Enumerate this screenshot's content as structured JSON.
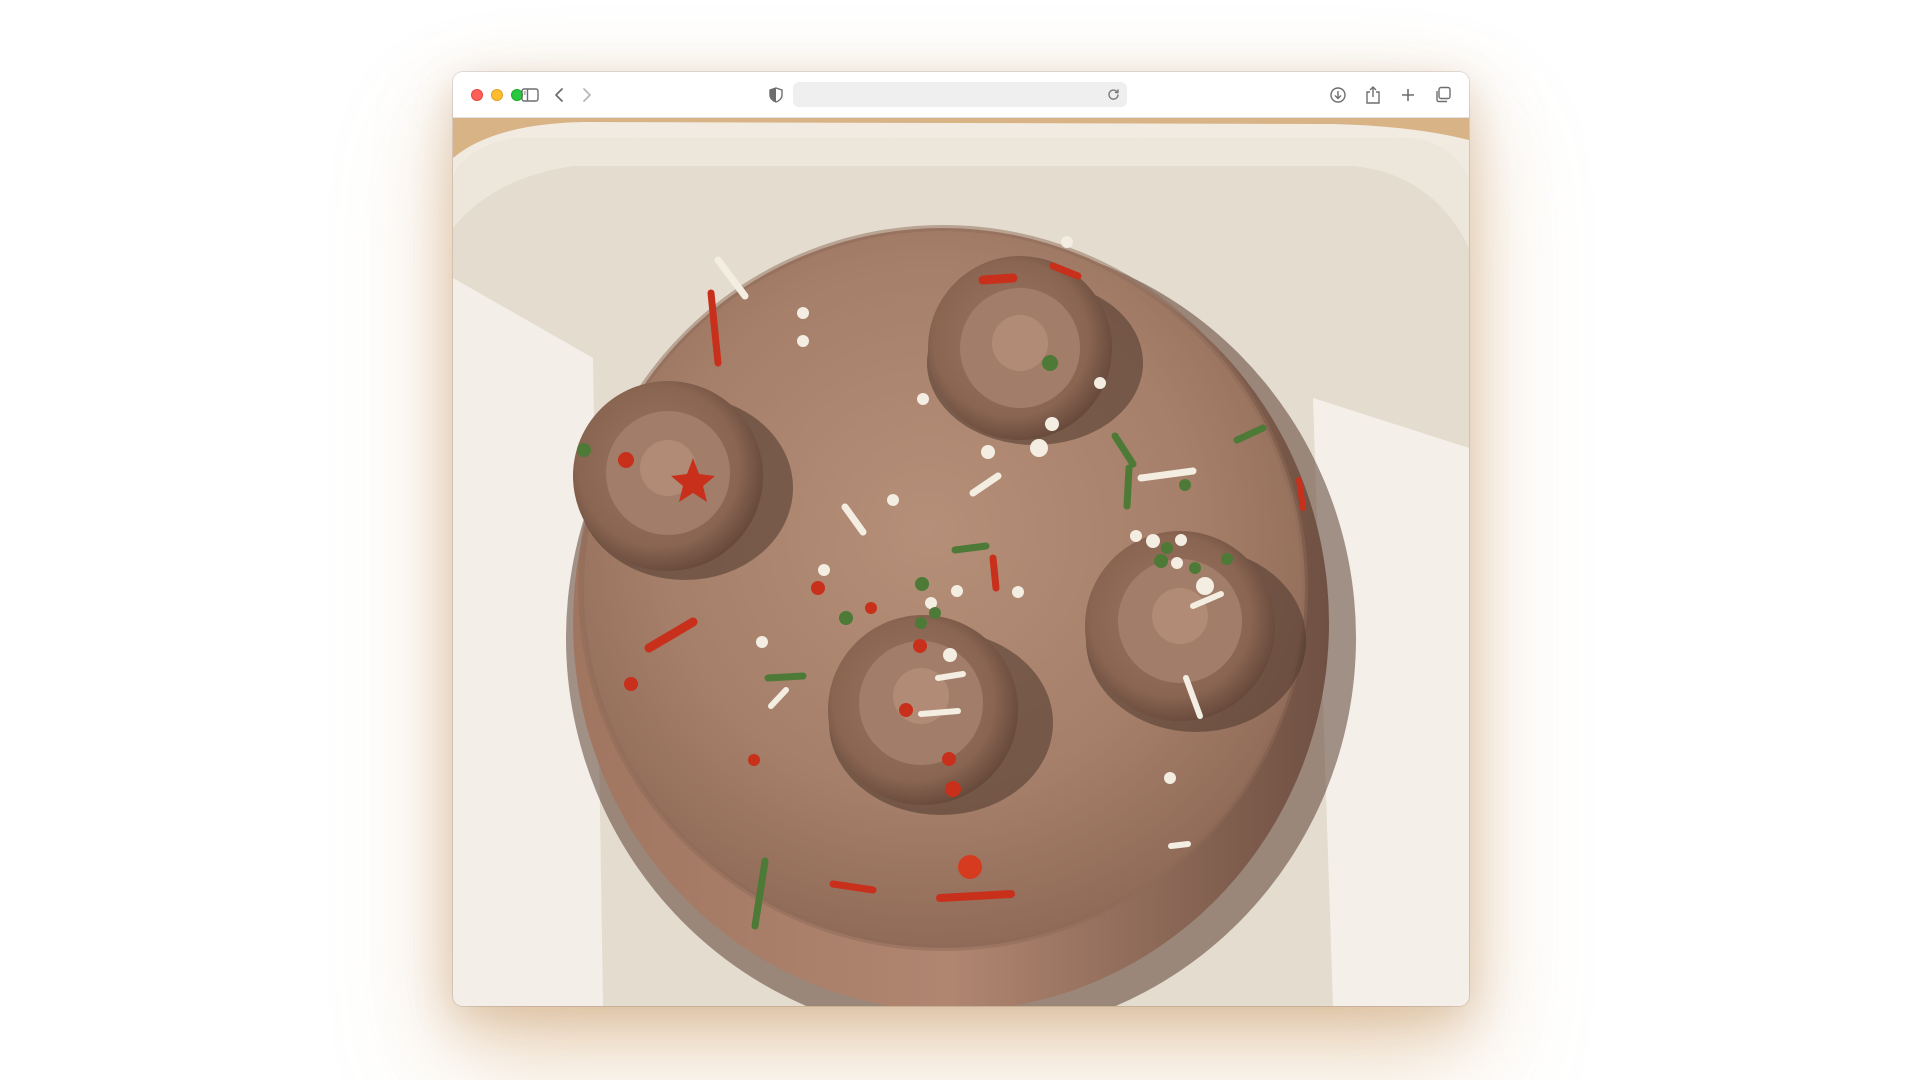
{
  "browser": {
    "address_bar": {
      "value": "",
      "placeholder": ""
    },
    "toolbar_icons": {
      "sidebar": "sidebar-icon",
      "back": "chevron-left-icon",
      "forward": "chevron-right-icon",
      "privacy": "shield-icon",
      "reload": "reload-icon",
      "downloads": "download-icon",
      "share": "share-icon",
      "new_tab": "plus-icon",
      "tab_overview": "tabs-icon"
    },
    "traffic_lights": {
      "close": "#fe5f57",
      "minimize": "#febc2e",
      "zoom": "#28c840"
    }
  },
  "photo": {
    "subject": "chocolate-cake-in-box",
    "colors": {
      "frosting": "#a57f69",
      "frosting_shadow": "#6e4f3f",
      "box": "#eee7dc",
      "table": "#d9b48a",
      "sprinkle_red": "#c8301c",
      "sprinkle_green": "#4d7a36",
      "sprinkle_white": "#f3ede2"
    }
  }
}
